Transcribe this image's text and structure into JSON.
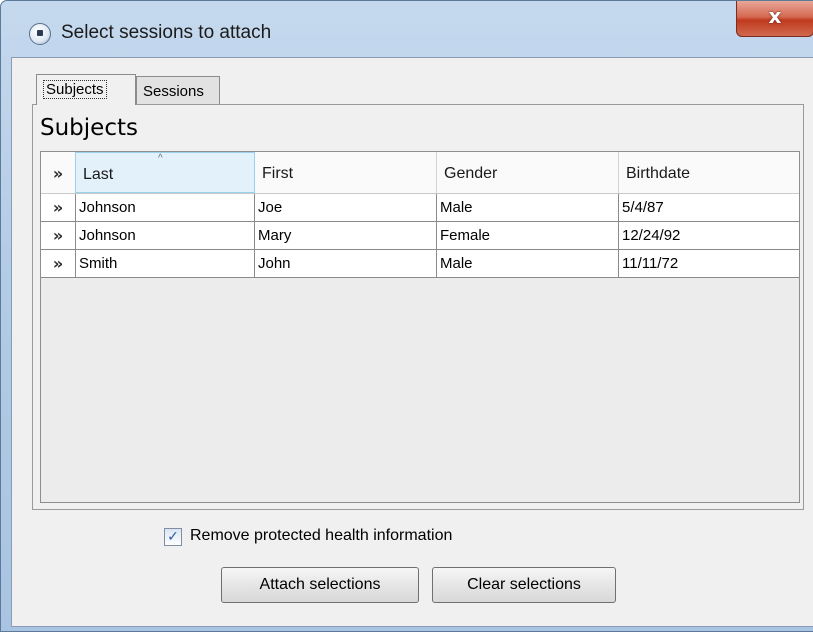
{
  "window": {
    "title": "Select sessions to attach",
    "close_glyph": "x"
  },
  "tabs": [
    {
      "label": "Subjects",
      "active": true
    },
    {
      "label": "Sessions",
      "active": false
    }
  ],
  "panel": {
    "title": "Subjects",
    "table": {
      "row_marker": "»",
      "sort_indicator": "^",
      "sorted_column": "Last",
      "columns": [
        "Last",
        "First",
        "Gender",
        "Birthdate"
      ],
      "rows": [
        [
          "Johnson",
          "Joe",
          "Male",
          "5/4/87"
        ],
        [
          "Johnson",
          "Mary",
          "Female",
          "12/24/92"
        ],
        [
          "Smith",
          "John",
          "Male",
          "11/11/72"
        ]
      ]
    }
  },
  "options": {
    "remove_phi_label": "Remove protected health information",
    "remove_phi_checked": true,
    "check_glyph": "✓"
  },
  "buttons": {
    "attach_label": "Attach selections",
    "clear_label": "Clear selections"
  },
  "colors": {
    "titlebar": "#b2cbe6",
    "close_button": "#c13a1f",
    "sorted_header": "#e3f1fb"
  }
}
